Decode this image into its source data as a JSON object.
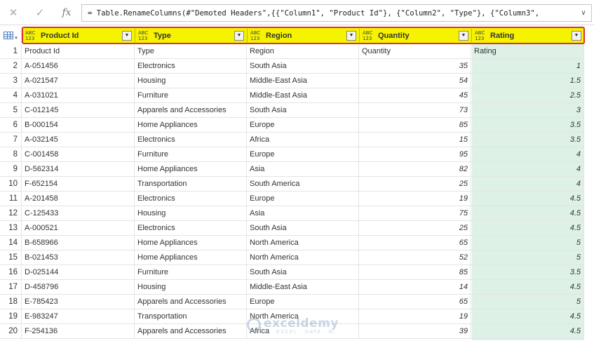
{
  "formula_bar": {
    "cancel_icon": "close-icon",
    "confirm_icon": "check-icon",
    "fx_label": "fx",
    "formula": "= Table.RenameColumns(#\"Demoted Headers\",{{\"Column1\", \"Product Id\"}, {\"Column2\", \"Type\"}, {\"Column3\",",
    "expand_icon": "chevron-down-icon"
  },
  "colors": {
    "header_highlight": "#f6f300",
    "highlight_border": "#e03030",
    "selected_column": "#ddf1e7"
  },
  "columns": [
    {
      "type_top": "ABC",
      "type_bottom": "123",
      "name": "Product Id"
    },
    {
      "type_top": "ABC",
      "type_bottom": "123",
      "name": "Type"
    },
    {
      "type_top": "ABC",
      "type_bottom": "123",
      "name": "Region"
    },
    {
      "type_top": "ABC",
      "type_bottom": "123",
      "name": "Quantity"
    },
    {
      "type_top": "ABC",
      "type_bottom": "123",
      "name": "Rating"
    }
  ],
  "rows": [
    {
      "n": "1",
      "c": [
        "Product Id",
        "Type",
        "Region",
        "Quantity",
        "Rating"
      ]
    },
    {
      "n": "2",
      "c": [
        "A-051456",
        "Electronics",
        "South Asia",
        "35",
        "1"
      ]
    },
    {
      "n": "3",
      "c": [
        "A-021547",
        "Housing",
        "Middle-East Asia",
        "54",
        "1.5"
      ]
    },
    {
      "n": "4",
      "c": [
        "A-031021",
        "Furniture",
        "Middle-East Asia",
        "45",
        "2.5"
      ]
    },
    {
      "n": "5",
      "c": [
        "C-012145",
        "Apparels and Accessories",
        "South Asia",
        "73",
        "3"
      ]
    },
    {
      "n": "6",
      "c": [
        "B-000154",
        "Home Appliances",
        "Europe",
        "85",
        "3.5"
      ]
    },
    {
      "n": "7",
      "c": [
        "A-032145",
        "Electronics",
        "Africa",
        "15",
        "3.5"
      ]
    },
    {
      "n": "8",
      "c": [
        "C-001458",
        "Furniture",
        "Europe",
        "95",
        "4"
      ]
    },
    {
      "n": "9",
      "c": [
        "D-562314",
        "Home Appliances",
        "Asia",
        "82",
        "4"
      ]
    },
    {
      "n": "10",
      "c": [
        "F-652154",
        "Transportation",
        "South America",
        "25",
        "4"
      ]
    },
    {
      "n": "11",
      "c": [
        "A-201458",
        "Electronics",
        "Europe",
        "19",
        "4.5"
      ]
    },
    {
      "n": "12",
      "c": [
        "C-125433",
        "Housing",
        "Asia",
        "75",
        "4.5"
      ]
    },
    {
      "n": "13",
      "c": [
        "A-000521",
        "Electronics",
        "South Asia",
        "25",
        "4.5"
      ]
    },
    {
      "n": "14",
      "c": [
        "B-658966",
        "Home Appliances",
        "North America",
        "65",
        "5"
      ]
    },
    {
      "n": "15",
      "c": [
        "B-021453",
        "Home Appliances",
        "North America",
        "52",
        "5"
      ]
    },
    {
      "n": "16",
      "c": [
        "D-025144",
        "Furniture",
        "South Asia",
        "85",
        "3.5"
      ]
    },
    {
      "n": "17",
      "c": [
        "D-458796",
        "Housing",
        "Middle-East Asia",
        "14",
        "4.5"
      ]
    },
    {
      "n": "18",
      "c": [
        "E-785423",
        "Apparels and Accessories",
        "Europe",
        "65",
        "5"
      ]
    },
    {
      "n": "19",
      "c": [
        "E-983247",
        "Transportation",
        "North America",
        "19",
        "4.5"
      ]
    },
    {
      "n": "20",
      "c": [
        "F-254136",
        "Apparels and Accessories",
        "Africa",
        "39",
        "4.5"
      ]
    }
  ],
  "watermark": {
    "title": "exceldemy",
    "subtitle": "EXCEL · DATA · BI"
  }
}
